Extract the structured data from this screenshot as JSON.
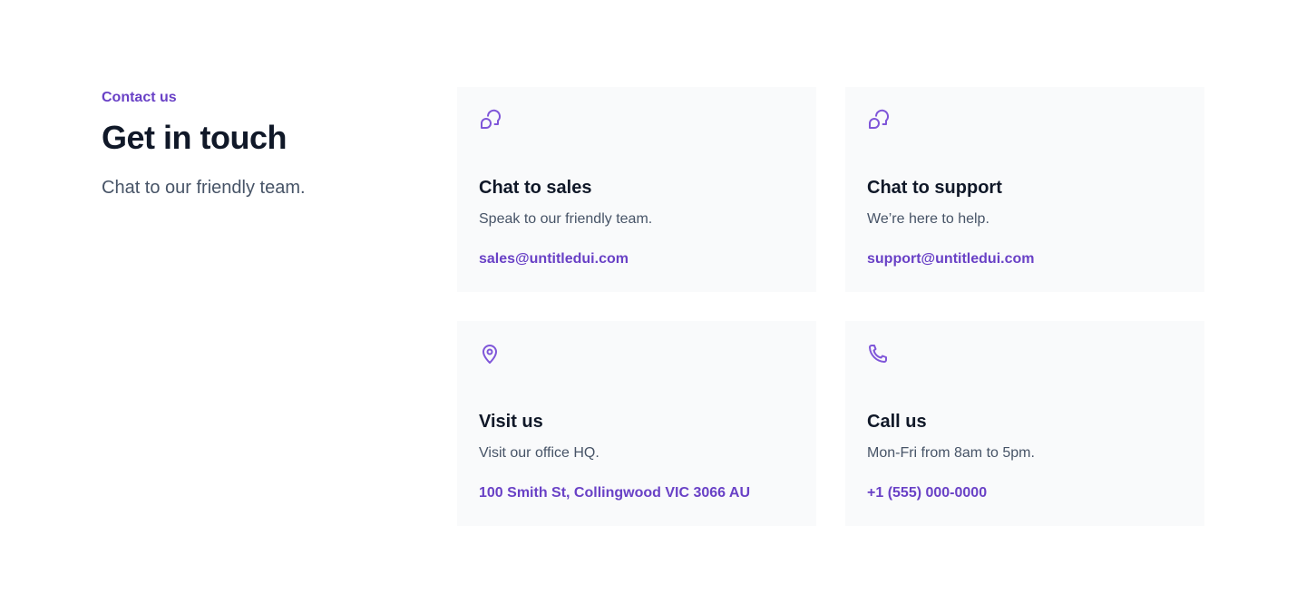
{
  "header": {
    "eyebrow": "Contact us",
    "title": "Get in touch",
    "subtitle": "Chat to our friendly team."
  },
  "colors": {
    "accent": "#6941C6",
    "icon": "#7F56D9",
    "card_bg": "#F9FAFB",
    "heading": "#101828",
    "body": "#475467"
  },
  "cards": [
    {
      "icon": "message-chat-icon",
      "title": "Chat to sales",
      "description": "Speak to our friendly team.",
      "link": "sales@untitledui.com"
    },
    {
      "icon": "message-chat-icon",
      "title": "Chat to support",
      "description": "We’re here to help.",
      "link": "support@untitledui.com"
    },
    {
      "icon": "map-pin-icon",
      "title": "Visit us",
      "description": "Visit our office HQ.",
      "link": "100 Smith St, Collingwood VIC 3066 AU"
    },
    {
      "icon": "phone-icon",
      "title": "Call us",
      "description": "Mon-Fri from 8am to 5pm.",
      "link": "+1 (555) 000-0000"
    }
  ]
}
